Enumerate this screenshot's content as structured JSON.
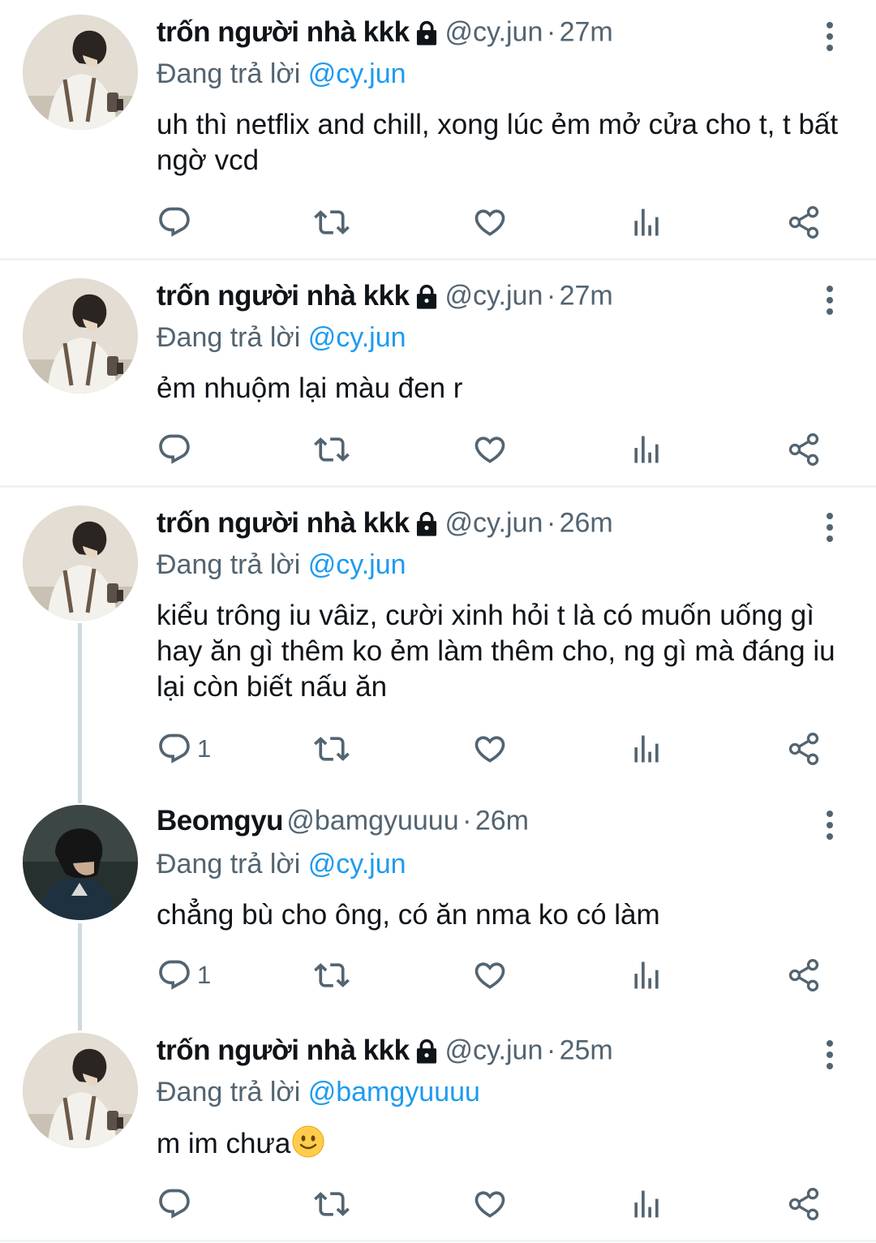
{
  "colors": {
    "accent": "#1d9bf0",
    "secondary_text": "#536471",
    "primary_text": "#0f1419",
    "divider": "#eff3f4"
  },
  "labels": {
    "replying_to": "Đang trả lời"
  },
  "tweets": [
    {
      "name": "trốn người nhà kkk",
      "locked": true,
      "handle": "@cy.jun",
      "time": "27m",
      "sep": "·",
      "reply_to": "@cy.jun",
      "text": "uh thì netflix and chill, xong lúc ẻm mở cửa cho t, t bất ngờ vcd",
      "reply_count": ""
    },
    {
      "name": "trốn người nhà kkk",
      "locked": true,
      "handle": "@cy.jun",
      "time": "27m",
      "sep": "·",
      "reply_to": "@cy.jun",
      "text": "ẻm nhuộm lại màu đen r",
      "reply_count": ""
    },
    {
      "name": "trốn người nhà kkk",
      "locked": true,
      "handle": "@cy.jun",
      "time": "26m",
      "sep": "·",
      "reply_to": "@cy.jun",
      "text": "kiểu trông iu vâiz, cười xinh hỏi t là có muốn uống gì hay ăn gì thêm ko ẻm làm thêm cho, ng gì mà đáng iu lại còn biết nấu ăn",
      "reply_count": "1"
    },
    {
      "name": "Beomgyu",
      "locked": false,
      "handle": "@bamgyuuuu",
      "time": "26m",
      "sep": "·",
      "reply_to": "@cy.jun",
      "text": "chẳng bù cho ông, có ăn nma ko có làm",
      "reply_count": "1"
    },
    {
      "name": "trốn người nhà kkk",
      "locked": true,
      "handle": "@cy.jun",
      "time": "25m",
      "sep": "·",
      "reply_to": "@bamgyuuuu",
      "text": "m im chưa",
      "emoji": "slightly-smiling-face-emoji",
      "reply_count": ""
    }
  ]
}
